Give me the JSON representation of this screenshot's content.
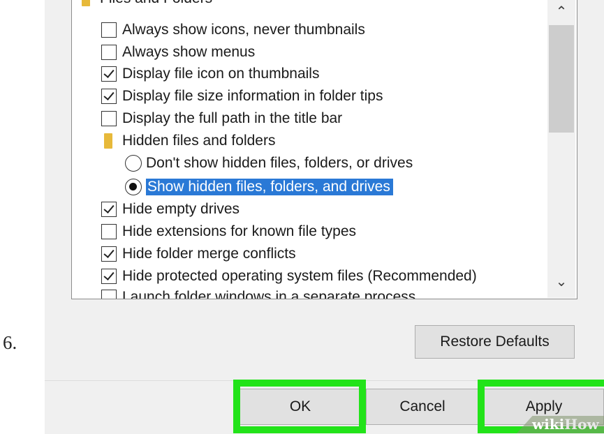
{
  "step_number": "6.",
  "tree": {
    "header_label": "Files and Folders",
    "items": [
      {
        "type": "checkbox",
        "checked": false,
        "label": "Always show icons, never thumbnails"
      },
      {
        "type": "checkbox",
        "checked": false,
        "label": "Always show menus"
      },
      {
        "type": "checkbox",
        "checked": true,
        "label": "Display file icon on thumbnails"
      },
      {
        "type": "checkbox",
        "checked": true,
        "label": "Display file size information in folder tips"
      },
      {
        "type": "checkbox",
        "checked": false,
        "label": "Display the full path in the title bar"
      },
      {
        "type": "folder",
        "label": "Hidden files and folders"
      },
      {
        "type": "radio",
        "selected": false,
        "label": "Don't show hidden files, folders, or drives"
      },
      {
        "type": "radio",
        "selected": true,
        "label": "Show hidden files, folders, and drives"
      },
      {
        "type": "checkbox",
        "checked": true,
        "label": "Hide empty drives"
      },
      {
        "type": "checkbox",
        "checked": false,
        "label": "Hide extensions for known file types"
      },
      {
        "type": "checkbox",
        "checked": true,
        "label": "Hide folder merge conflicts"
      },
      {
        "type": "checkbox",
        "checked": true,
        "label": "Hide protected operating system files (Recommended)"
      },
      {
        "type": "checkbox",
        "checked": false,
        "label": "Launch folder windows in a separate process"
      }
    ]
  },
  "scrollbar": {
    "up_icon": "chevron-up-icon",
    "down_icon": "chevron-down-icon"
  },
  "buttons": {
    "restore_defaults": "Restore Defaults",
    "ok": "OK",
    "cancel": "Cancel",
    "apply": "Apply"
  },
  "watermark": {
    "wiki": "wiki",
    "how": "How"
  },
  "colors": {
    "highlight": "#2a79d6",
    "emphasis_box": "#22e319",
    "folder": "#e7b93a"
  }
}
